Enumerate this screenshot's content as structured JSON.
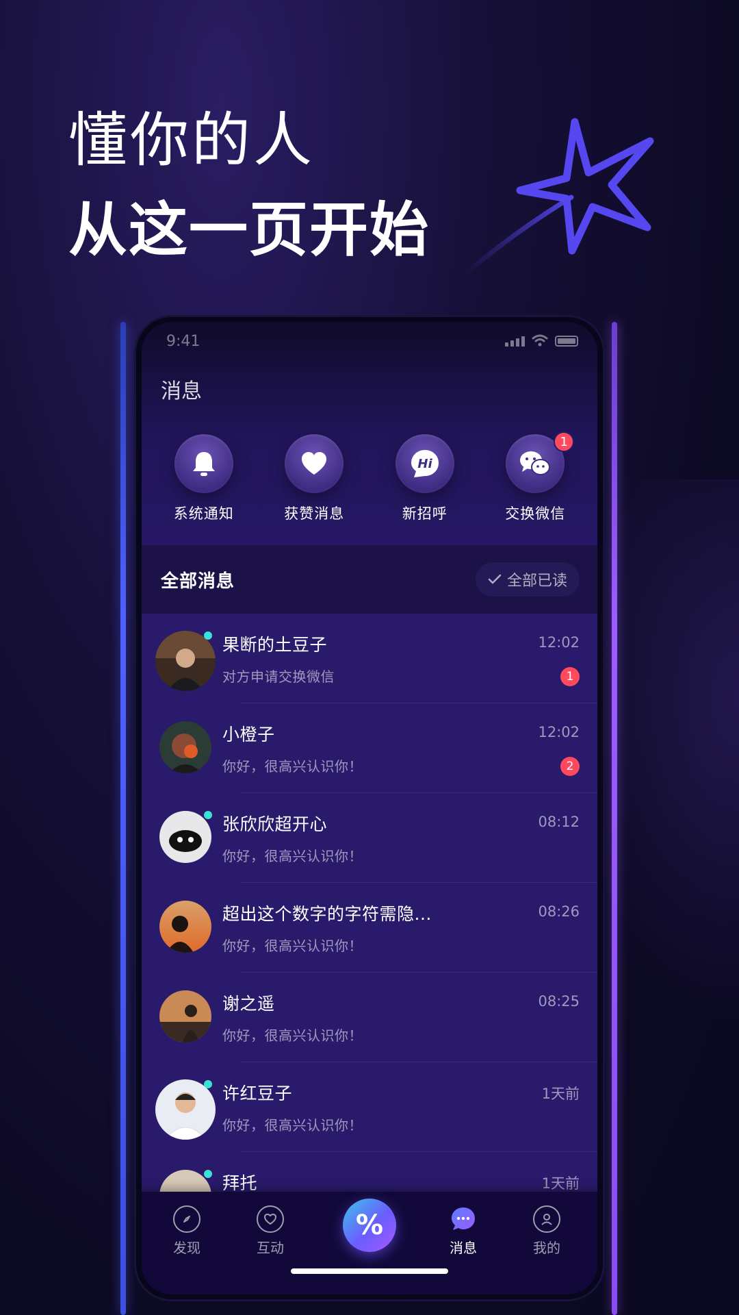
{
  "promo": {
    "line1": "懂你的人",
    "line2": "从这一页开始"
  },
  "status_bar": {
    "time": "9:41"
  },
  "page": {
    "title": "消息"
  },
  "quick_actions": [
    {
      "label": "系统通知",
      "icon": "bell-icon"
    },
    {
      "label": "获赞消息",
      "icon": "heart-icon"
    },
    {
      "label": "新招呼",
      "icon": "hi-icon",
      "icon_text": "Hi"
    },
    {
      "label": "交换微信",
      "icon": "wechat-icon",
      "badge": "1"
    }
  ],
  "section": {
    "title": "全部消息",
    "read_all": "全部已读"
  },
  "conversations": [
    {
      "name": "果断的土豆子",
      "preview": "对方申请交换微信",
      "time": "12:02",
      "badge": "1",
      "online": true
    },
    {
      "name": "小橙子",
      "preview": "你好，很高兴认识你！",
      "time": "12:02",
      "badge": "2",
      "online": false
    },
    {
      "name": "张欣欣超开心",
      "preview": "你好，很高兴认识你！",
      "time": "08:12",
      "badge": "",
      "online": true
    },
    {
      "name": "超出这个数字的字符需隐...",
      "preview": "你好，很高兴认识你！",
      "time": "08:26",
      "badge": "",
      "online": false
    },
    {
      "name": "谢之遥",
      "preview": "你好，很高兴认识你！",
      "time": "08:25",
      "badge": "",
      "online": false
    },
    {
      "name": "许红豆子",
      "preview": "你好，很高兴认识你！",
      "time": "1天前",
      "badge": "",
      "online": true
    },
    {
      "name": "拜托",
      "preview": "",
      "time": "1天前",
      "badge": "",
      "online": true
    }
  ],
  "tabbar": {
    "discover": "发现",
    "interact": "互动",
    "center_symbol": "%",
    "messages": "消息",
    "mine": "我的"
  },
  "colors": {
    "accent_badge": "#ff4a5e",
    "online_dot": "#38e3d6",
    "left_rail": "#4f61ff",
    "right_rail": "#9c5cff"
  }
}
